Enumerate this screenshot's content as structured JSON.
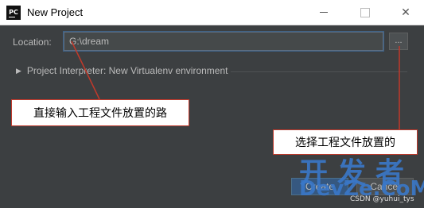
{
  "window": {
    "app_icon_text": "PC",
    "title": "New Project",
    "minimize_glyph": "",
    "close_glyph": "✕"
  },
  "form": {
    "location_label": "Location:",
    "location_value": "G:\\dream",
    "browse_label": "...",
    "interpreter_label": "Project Interpreter: New Virtualenv environment"
  },
  "buttons": {
    "create_label": "Create",
    "cancel_label": "Cancel"
  },
  "annotations": {
    "note_location": "直接输入工程文件放置的路",
    "note_browse": "选择工程文件放置的"
  },
  "watermark": {
    "line1": "开发者",
    "line2": "DevZe.CoM",
    "line3": "CSDN @yuhui_tys"
  },
  "colors": {
    "dialog_bg": "#3c3f41",
    "accent_border": "#c0392b",
    "watermark": "#3a78c9"
  }
}
